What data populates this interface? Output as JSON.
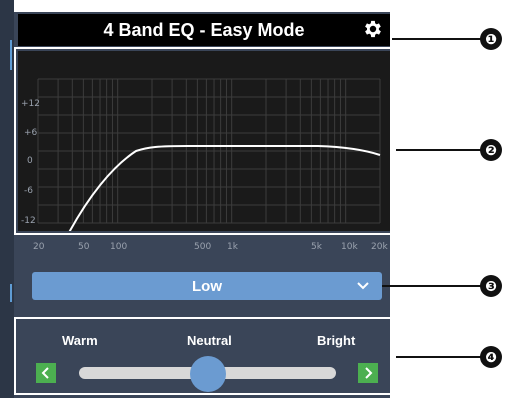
{
  "header": {
    "title": "4 Band EQ - Easy Mode",
    "settings_icon": "gear-icon"
  },
  "graph": {
    "y_ticks": [
      "+12",
      "+6",
      "0",
      "-6",
      "-12"
    ],
    "x_ticks": [
      "20",
      "50",
      "100",
      "500",
      "1k",
      "5k",
      "10k",
      "20k"
    ],
    "curve_color": "#ffffff"
  },
  "band_select": {
    "value": "Low",
    "dropdown_icon": "chevron-down-icon"
  },
  "tone": {
    "warm_label": "Warm",
    "neutral_label": "Neutral",
    "bright_label": "Bright",
    "position": 0.5,
    "left_icon": "chevron-left-icon",
    "right_icon": "chevron-right-icon"
  },
  "callouts": [
    "❶",
    "❷",
    "❸",
    "❹"
  ],
  "colors": {
    "accent": "#6b9bd1",
    "arrow_button": "#4caf50",
    "panel": "#3a4558"
  }
}
